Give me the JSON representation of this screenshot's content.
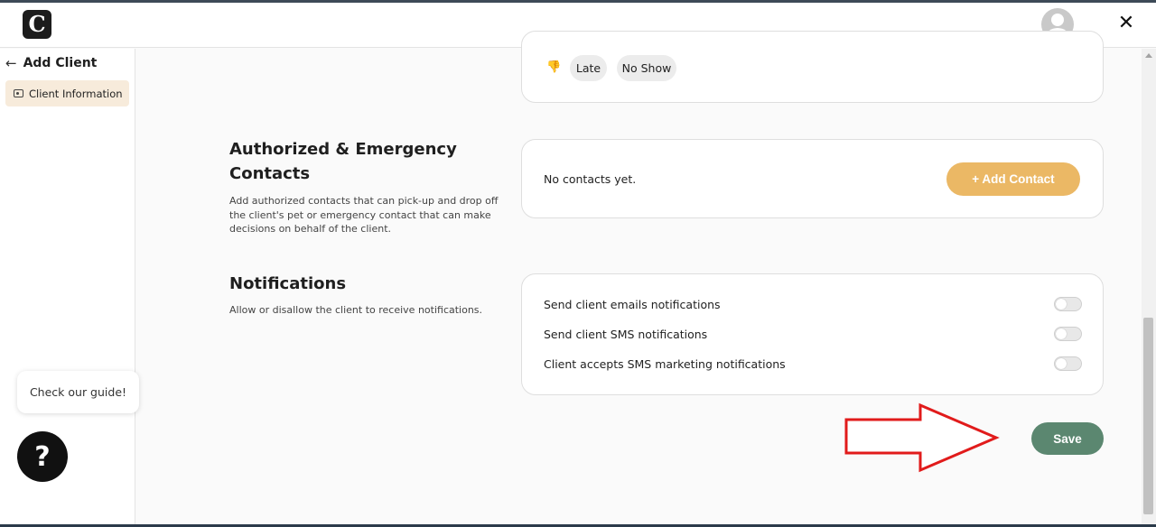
{
  "header": {
    "logo_letter": "C",
    "logo_icon": "app-logo-icon",
    "avatar_icon": "user-avatar-icon",
    "close_glyph": "✕"
  },
  "sidebar": {
    "back_glyph": "←",
    "title": "Add Client",
    "items": [
      {
        "label": "Client Information",
        "icon": "id-card-icon",
        "active": true
      }
    ]
  },
  "attendance": {
    "thumb_icon": "thumbs-down-icon",
    "thumb_glyph": "👎",
    "chips": [
      "Late",
      "No Show"
    ]
  },
  "contacts_section": {
    "title": "Authorized & Emergency Contacts",
    "description": "Add authorized contacts that can pick-up and drop off the client's pet or emergency contact that can make decisions on behalf of the client.",
    "empty_text": "No contacts yet.",
    "add_button": "+ Add Contact"
  },
  "notifications_section": {
    "title": "Notifications",
    "description": "Allow or disallow the client to receive notifications.",
    "options": [
      {
        "label": "Send client emails notifications",
        "enabled": false
      },
      {
        "label": "Send client SMS notifications",
        "enabled": false
      },
      {
        "label": "Client accepts SMS marketing notifications",
        "enabled": false
      }
    ]
  },
  "actions": {
    "save_label": "Save"
  },
  "help": {
    "guide_text": "Check our guide!",
    "help_glyph": "?"
  },
  "colors": {
    "accent_orange": "#ebb865",
    "save_green": "#5b8770",
    "active_item_bg": "#f7ebdb",
    "annotation_red": "#e11b1b"
  }
}
